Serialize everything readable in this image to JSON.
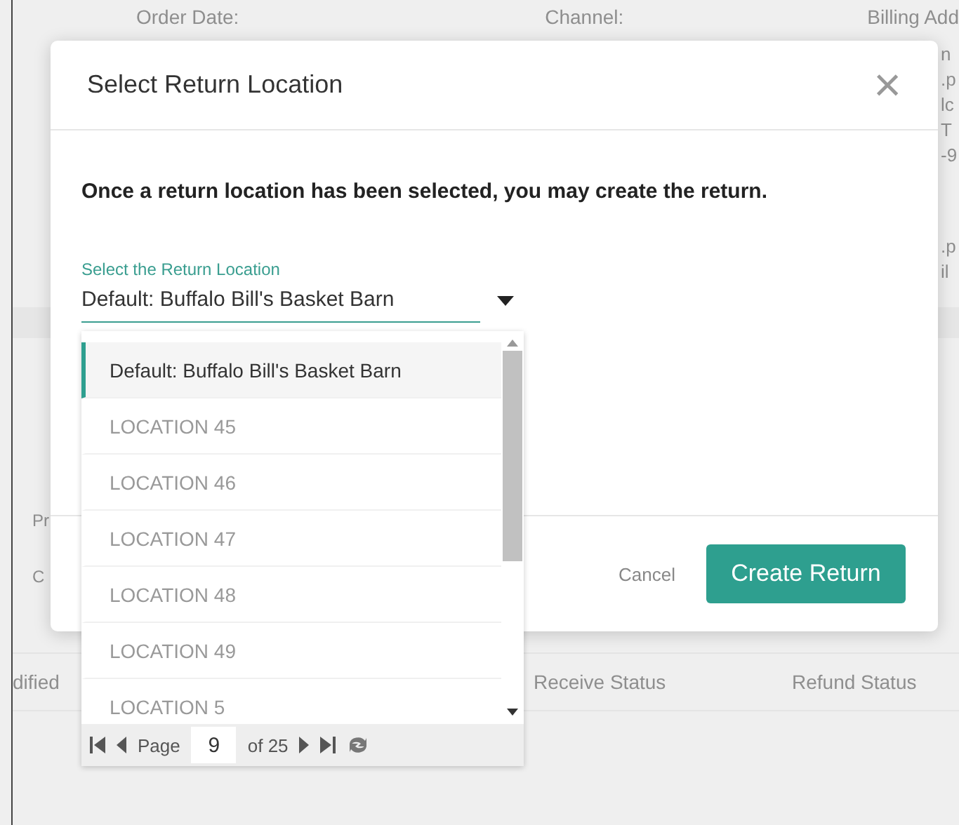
{
  "background_page": {
    "header_labels": [
      "Order Date:",
      "Channel:",
      "Billing Add"
    ],
    "address_fragments": [
      "n",
      ".p",
      "lc",
      "T",
      "-9"
    ],
    "email_fragments": [
      ".p",
      "il"
    ],
    "left_fragments": [
      "Pr",
      "C"
    ],
    "table_columns": [
      "dified",
      "Receive Status",
      "Refund Status"
    ]
  },
  "dialog": {
    "title": "Select Return Location",
    "close": "×",
    "message": "Once a return location has been selected, you may create the return.",
    "location_select": {
      "label": "Select the Return Location",
      "value": "Default: Buffalo Bill's Basket Barn",
      "expanded": true
    },
    "options": [
      {
        "label": "Default: Buffalo Bill's Basket Barn",
        "selected": true
      },
      {
        "label": "LOCATION 45",
        "selected": false
      },
      {
        "label": "LOCATION 46",
        "selected": false
      },
      {
        "label": "LOCATION 47",
        "selected": false
      },
      {
        "label": "LOCATION 48",
        "selected": false
      },
      {
        "label": "LOCATION 49",
        "selected": false
      },
      {
        "label": "LOCATION 5",
        "selected": false
      }
    ],
    "pager": {
      "page_label": "Page",
      "page": "9",
      "of_total": "of 25"
    },
    "buttons": [
      {
        "label": "Cancel",
        "kind": "secondary"
      },
      {
        "label": "Create Return",
        "kind": "primary"
      }
    ]
  }
}
